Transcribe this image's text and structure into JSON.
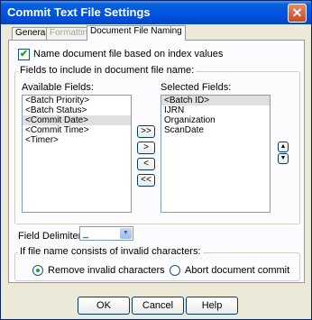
{
  "window": {
    "title": "Commit Text File Settings",
    "close_glyph": "✕"
  },
  "tabs": [
    {
      "label": "General",
      "state": "normal"
    },
    {
      "label": "Formatting",
      "state": "disabled"
    },
    {
      "label": "Document File Naming",
      "state": "active"
    }
  ],
  "name_by_index": {
    "label": "Name document file based on index values",
    "checked": true,
    "check_glyph": "✔"
  },
  "fields_group": {
    "title": "Fields to include in document file name:",
    "available": {
      "label": "Available Fields:",
      "items": [
        "<Batch Priority>",
        "<Batch Status>",
        "<Commit Date>",
        "<Commit Time>",
        "<Timer>"
      ],
      "selected_index": 2
    },
    "selected": {
      "label": "Selected Fields:",
      "items": [
        "<Batch ID>",
        "IJRN",
        "Organization",
        "ScanDate"
      ],
      "selected_index": 0
    },
    "move_buttons": [
      ">>",
      ">",
      "<",
      "<<"
    ],
    "order_buttons": [
      "▲",
      "▼"
    ]
  },
  "delimiter": {
    "label": "Field Delimiter:",
    "value": "_",
    "arrow_glyph": "▼"
  },
  "invalid_group": {
    "title": "If file name consists of invalid characters:",
    "options": [
      {
        "label": "Remove invalid characters",
        "checked": true
      },
      {
        "label": "Abort document commit",
        "checked": false
      }
    ]
  },
  "footer": {
    "ok": "OK",
    "cancel": "Cancel",
    "help": "Help"
  }
}
